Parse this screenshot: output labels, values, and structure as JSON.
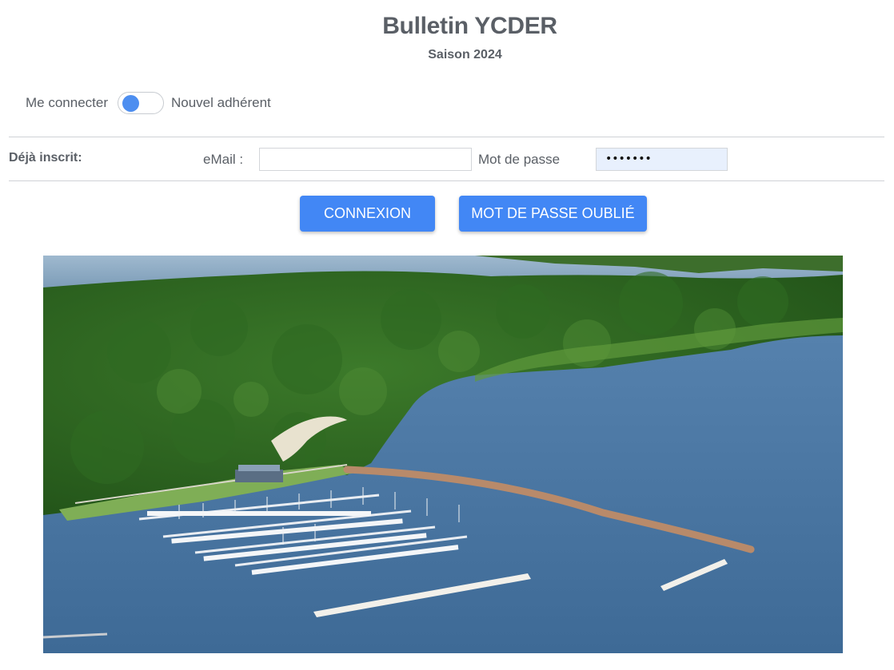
{
  "header": {
    "title": "Bulletin YCDER",
    "subtitle": "Saison 2024"
  },
  "mode_toggle": {
    "left_label": "Me connecter",
    "right_label": "Nouvel adhérent"
  },
  "login": {
    "section_label": "Déjà inscrit:",
    "email_label": "eMail :",
    "email_value": "",
    "password_label": "Mot de passe",
    "password_value": "•••••••"
  },
  "buttons": {
    "connexion": "CONNEXION",
    "forgot_password": "MOT DE PASSE OUBLIÉ"
  },
  "colors": {
    "accent": "#4287f5",
    "text": "#5a5f66"
  }
}
